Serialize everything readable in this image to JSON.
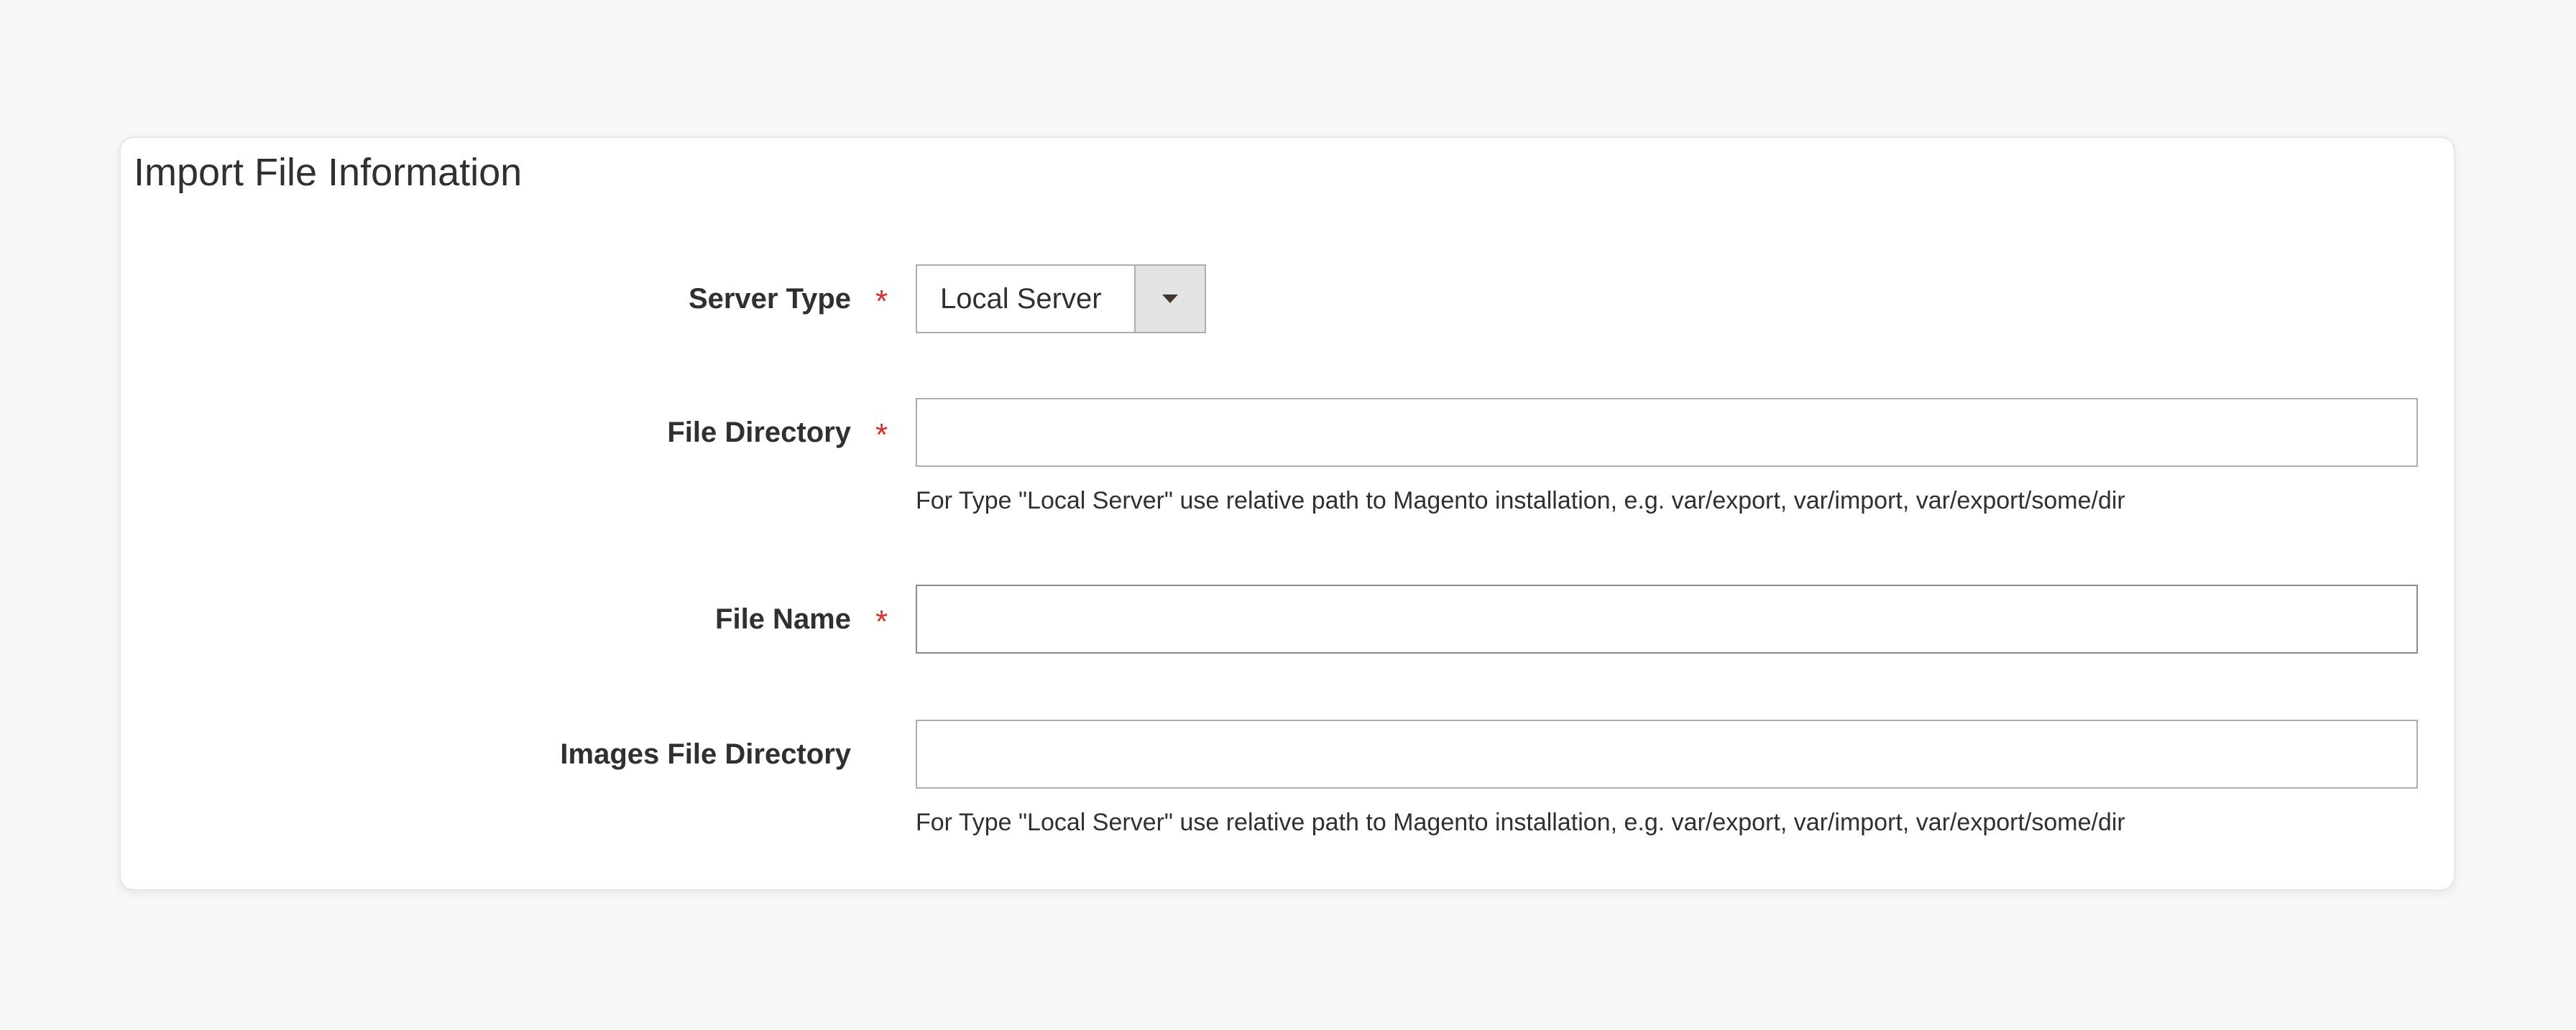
{
  "section": {
    "title": "Import File Information"
  },
  "fields": {
    "server_type": {
      "label": "Server Type",
      "required": "*",
      "selected": "Local Server",
      "options": [
        "Local Server"
      ]
    },
    "file_directory": {
      "label": "File Directory",
      "required": "*",
      "value": "",
      "note": "For Type \"Local Server\" use relative path to Magento installation, e.g. var/export, var/import, var/export/some/dir"
    },
    "file_name": {
      "label": "File Name",
      "required": "*",
      "value": ""
    },
    "images_file_directory": {
      "label": "Images File Directory",
      "value": "",
      "note": "For Type \"Local Server\" use relative path to Magento installation, e.g. var/export, var/import, var/export/some/dir"
    }
  },
  "icons": {
    "dropdown": "chevron-down-icon"
  },
  "colors": {
    "required": "#e02b27",
    "background": "#f8f8f8",
    "card": "#ffffff",
    "border": "#adadad",
    "select_button": "#e3e3e3"
  }
}
